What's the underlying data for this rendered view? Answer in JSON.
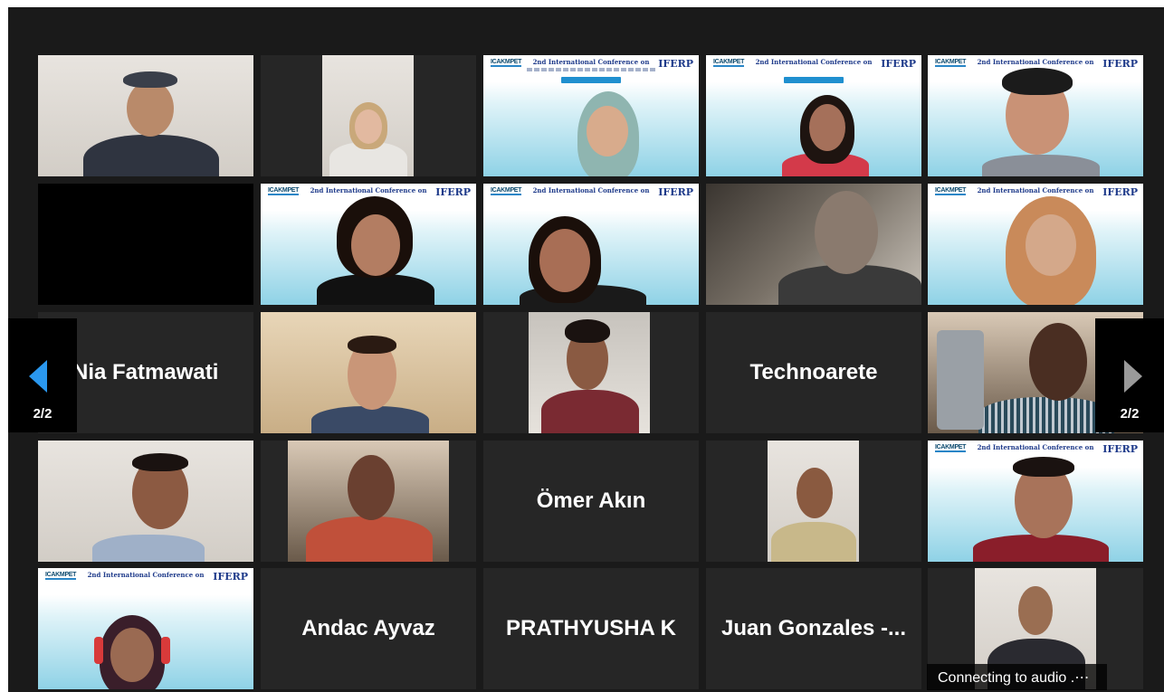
{
  "pagination": {
    "prev_page": "2/2",
    "next_page": "2/2"
  },
  "participants": {
    "nia": "Nia Fatmawati",
    "technoarete": "Technoarete",
    "omer": "Ömer Akın",
    "andac": "Andac Ayvaz",
    "prathyusha": "PRATHYUSHA K",
    "juan": "Juan Gonzales -..."
  },
  "banner": {
    "left_logo": "ICAKMPET",
    "title": "2nd International Conference on",
    "right_logo": "IFERP"
  },
  "status": {
    "audio": "Connecting to audio .⋯"
  },
  "colors": {
    "window_bg": "#1a1a1a",
    "tile_bg": "#262626",
    "arrow_active": "#2a98ef",
    "arrow_inactive": "#9a9a9a"
  }
}
